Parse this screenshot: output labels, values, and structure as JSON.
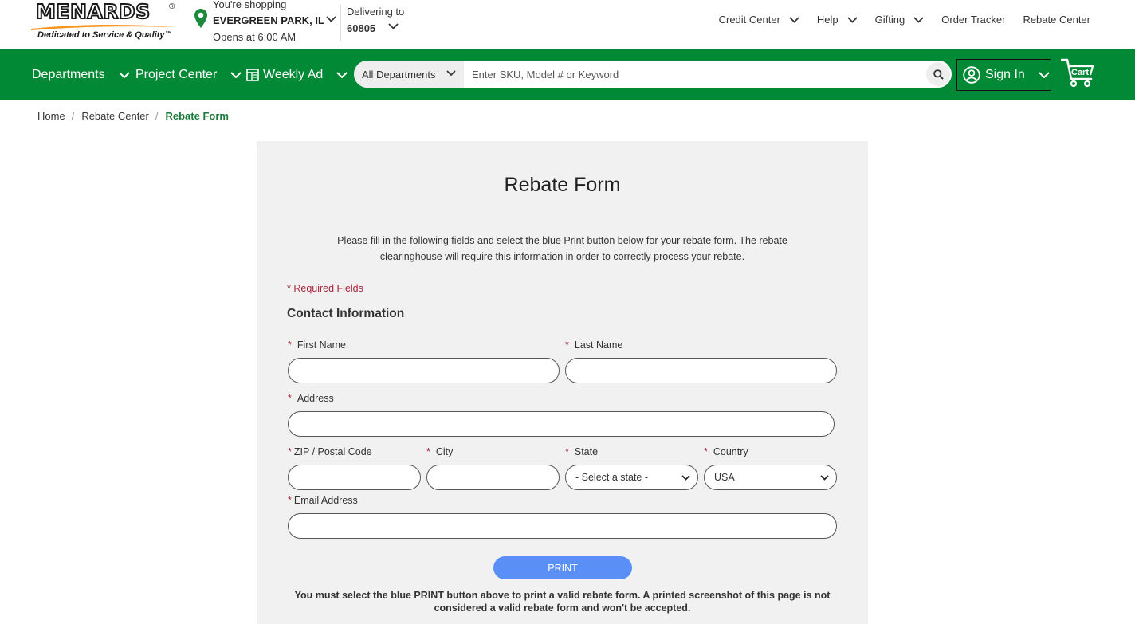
{
  "brand": {
    "name": "MENARDS",
    "registered": "®",
    "tagline": "Dedicated to Service & Quality℠"
  },
  "store": {
    "label": "You're shopping",
    "location": "EVERGREEN PARK, IL",
    "hours": "Opens at 6:00 AM"
  },
  "delivery": {
    "label": "Delivering to",
    "zip": "60805"
  },
  "utility_nav": {
    "credit_center": "Credit Center",
    "help": "Help",
    "gifting": "Gifting",
    "order_tracker": "Order Tracker",
    "rebate_center": "Rebate Center"
  },
  "main_nav": {
    "departments": "Departments",
    "project_center": "Project Center",
    "weekly_ad": "Weekly Ad"
  },
  "search": {
    "department": "All Departments",
    "placeholder": "Enter SKU, Model # or Keyword"
  },
  "account": {
    "sign_in": "Sign In",
    "cart": "Cart"
  },
  "colors": {
    "brand_green": "#018936",
    "print_blue": "#5b8ff8",
    "required_red": "#a6253c",
    "breadcrumb_current": "#1b7a3a"
  },
  "breadcrumb": {
    "home": "Home",
    "rebate_center": "Rebate Center",
    "current": "Rebate Form",
    "separator": "/"
  },
  "form": {
    "title": "Rebate Form",
    "intro": "Please fill in the following fields and select the blue Print button below for your rebate form. The rebate clearinghouse will require this information in order to correctly process your rebate.",
    "required_note": "* Required Fields",
    "section_title": "Contact Information",
    "asterisk": "*",
    "labels": {
      "first_name": "First Name",
      "last_name": "Last Name",
      "address": "Address",
      "zip": "ZIP / Postal Code",
      "city": "City",
      "state": "State",
      "country": "Country",
      "email": "Email Address"
    },
    "values": {
      "first_name": "",
      "last_name": "",
      "address": "",
      "zip": "",
      "city": "",
      "email": ""
    },
    "state_selected": "- Select a state -",
    "country_selected": "USA",
    "print_label": "PRINT",
    "warning": "You must select the blue PRINT button above to print a valid rebate form. A printed screenshot of this page is not considered a valid rebate form and won't be accepted."
  }
}
